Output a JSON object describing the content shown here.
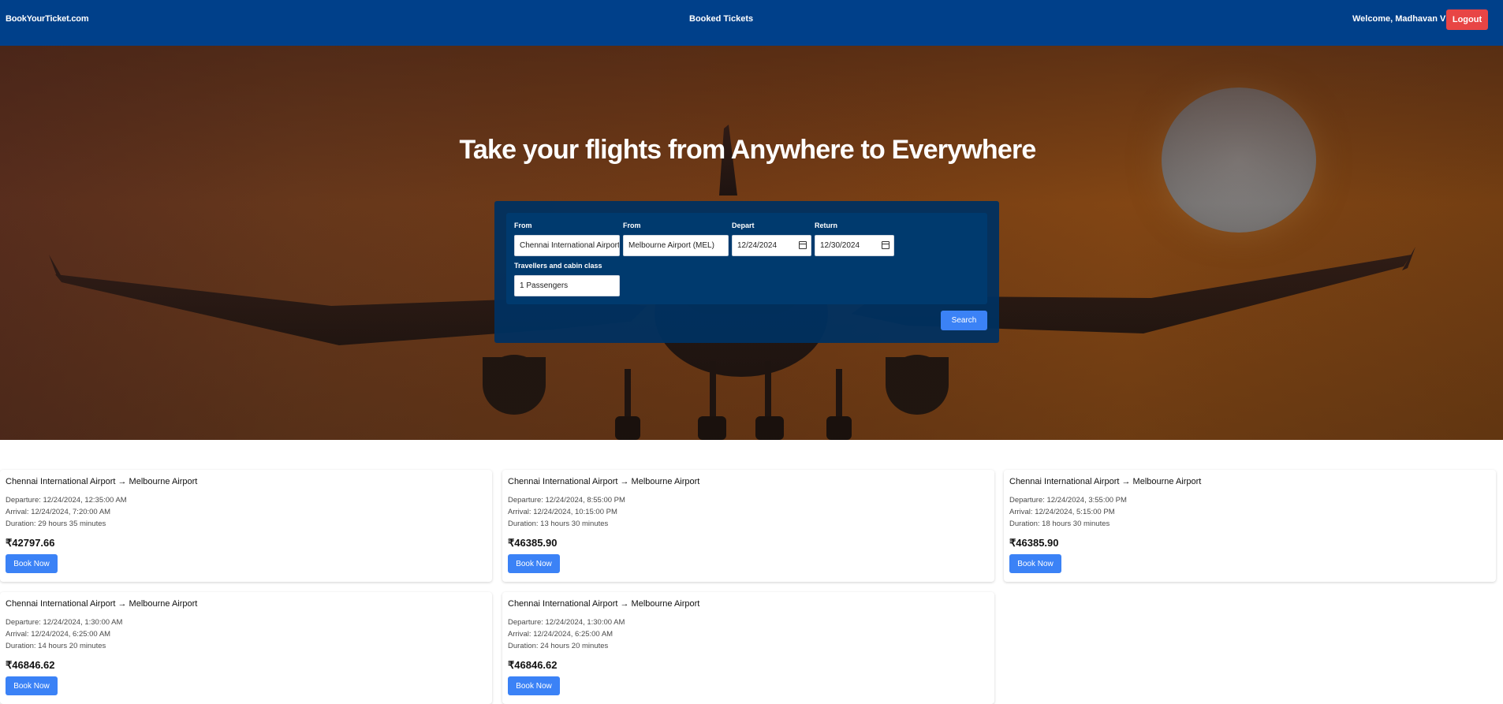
{
  "navbar": {
    "brand": "BookYourTicket.com",
    "booked_tickets": "Booked Tickets",
    "welcome": "Welcome, Madhavan V",
    "logout": "Logout"
  },
  "hero": {
    "title": "Take your flights from Anywhere to Everywhere"
  },
  "search": {
    "from_label": "From",
    "from_value": "Chennai International Airport",
    "to_label": "From",
    "to_value": "Melbourne Airport (MEL)",
    "depart_label": "Depart",
    "depart_value": "12/24/2024",
    "return_label": "Return",
    "return_value": "12/30/2024",
    "travellers_label": "Travellers and cabin class",
    "travellers_value": "1 Passengers",
    "search_button": "Search"
  },
  "results": [
    {
      "title": "Chennai International Airport → Melbourne Airport",
      "departure": "Departure: 12/24/2024, 12:35:00 AM",
      "arrival": "Arrival: 12/24/2024, 7:20:00 AM",
      "duration": "Duration: 29 hours 35 minutes",
      "price": "₹42797.66",
      "button": "Book Now"
    },
    {
      "title": "Chennai International Airport → Melbourne Airport",
      "departure": "Departure: 12/24/2024, 8:55:00 PM",
      "arrival": "Arrival: 12/24/2024, 10:15:00 PM",
      "duration": "Duration: 13 hours 30 minutes",
      "price": "₹46385.90",
      "button": "Book Now"
    },
    {
      "title": "Chennai International Airport → Melbourne Airport",
      "departure": "Departure: 12/24/2024, 3:55:00 PM",
      "arrival": "Arrival: 12/24/2024, 5:15:00 PM",
      "duration": "Duration: 18 hours 30 minutes",
      "price": "₹46385.90",
      "button": "Book Now"
    },
    {
      "title": "Chennai International Airport → Melbourne Airport",
      "departure": "Departure: 12/24/2024, 1:30:00 AM",
      "arrival": "Arrival: 12/24/2024, 6:25:00 AM",
      "duration": "Duration: 14 hours 20 minutes",
      "price": "₹46846.62",
      "button": "Book Now"
    },
    {
      "title": "Chennai International Airport → Melbourne Airport",
      "departure": "Departure: 12/24/2024, 1:30:00 AM",
      "arrival": "Arrival: 12/24/2024, 6:25:00 AM",
      "duration": "Duration: 24 hours 20 minutes",
      "price": "₹46846.62",
      "button": "Book Now"
    }
  ],
  "colors": {
    "navbar": "#00408a",
    "logout": "#e84545",
    "primary_button": "#3b82f6",
    "search_panel": "#003a6e"
  }
}
